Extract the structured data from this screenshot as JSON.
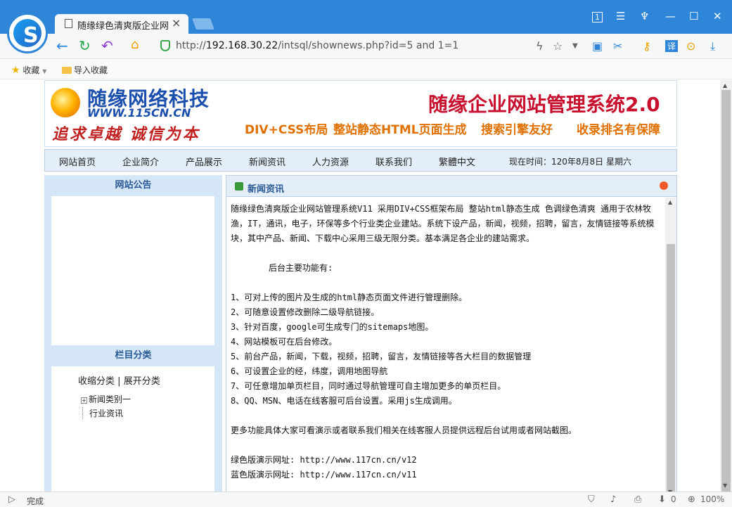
{
  "browser": {
    "tab_title": "随缘绿色清爽版企业网站",
    "tab_close": "×",
    "url_prefix": "http://",
    "url_host": "192.168.30.22",
    "url_path": "/intsql/shownews.php?id=5 and 1=1",
    "bookmarks": {
      "favorites": "收藏",
      "import": "导入收藏"
    },
    "status": "完成",
    "zoom": "100%",
    "download_count": "0",
    "tab_badge": "1"
  },
  "site": {
    "brand_name": "随缘网络科技",
    "brand_url": "WWW.115CN.CN",
    "slogan": "追求卓越 诚信为本",
    "system_title": "随缘企业网站管理系统2.0",
    "features": [
      "DIV+CSS布局",
      "整站静态HTML页面生成",
      "搜索引擎友好",
      "收录排名有保障"
    ]
  },
  "nav": {
    "items": [
      "网站首页",
      "企业简介",
      "产品展示",
      "新闻资讯",
      "人力资源",
      "联系我们",
      "繁體中文"
    ],
    "time_text": "现在时间：120年8月8日 星期六"
  },
  "sidebar": {
    "notice_title": "网站公告",
    "category_title": "栏目分类",
    "collapse": "收缩分类",
    "separator": "|",
    "expand": "展开分类",
    "tree": [
      "新闻类别一",
      "行业资讯"
    ]
  },
  "main": {
    "title": "新闻资讯",
    "paragraphs": [
      "随缘绿色清爽版企业网站管理系统V11   采用DIV+CSS框架布局 整站html静态生成 色调绿色清爽 通用于农林牧渔，IT，通讯，电子，环保等多个行业类企业建站。系统下设产品，新闻，视频，招聘，留言，友情链接等系统模块，其中产品、新闻、下载中心采用三级无限分类。基本满足各企业的建站需求。",
      "",
      "后台主要功能有:",
      "",
      "1、可对上传的图片及生成的html静态页面文件进行管理删除。",
      "2、可随意设置修改删除二级导航链接。",
      "3、针对百度，google可生成专门的sitemaps地图。",
      "4、网站模板可在后台修改。",
      "5、前台产品，新闻，下载，视频，招聘，留言，友情链接等各大栏目的数据管理",
      "6、可设置企业的经，纬度，调用地图导航",
      "7、可任意增加单页栏目，同时通过导航管理可自主增加更多的单页栏目。",
      "8、QQ、MSN、电话在线客服可后台设置。采用js生成调用。",
      "",
      "更多功能具体大家可看演示或者联系我们相关在线客服人员提供远程后台试用或者网站截图。",
      "",
      "绿色版演示网址: http://www.117cn.cn/v12",
      "蓝色版演示网址: http://www.117cn.cn/v11"
    ]
  },
  "colors": {
    "chrome_blue": "#2f86d8",
    "panel_blue": "#d5e6f6",
    "accent_red": "#c8102e",
    "accent_orange": "#e07000"
  }
}
